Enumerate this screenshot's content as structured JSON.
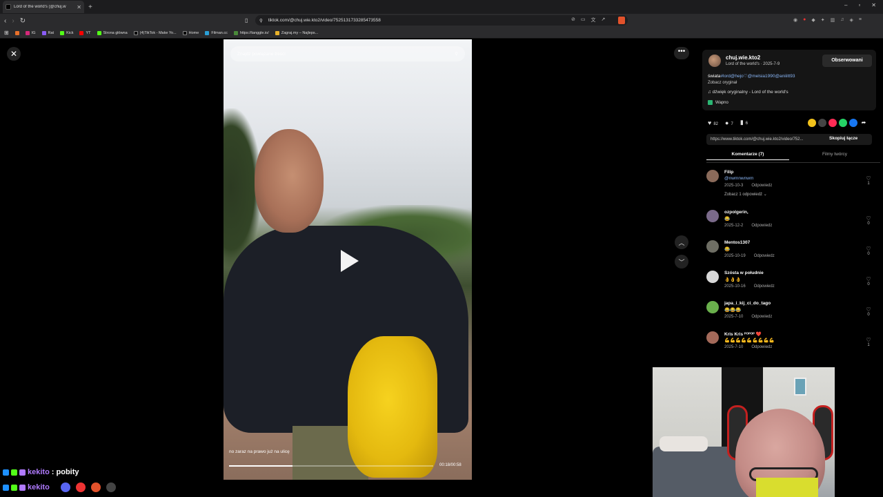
{
  "browser": {
    "tab_title": "Lord of the world's (@chuj.w",
    "url": "tiktok.com/@chuj.wie.kto2/video/7525131733285473558",
    "bookmarks": [
      "IG",
      "Rat",
      "Kick",
      "YT",
      "Strona główna",
      "(4)TikTok - Make Yo...",
      "Home",
      "Filman.cc",
      "https://tanggle.io/",
      "Zagraj.my – Najleps..."
    ]
  },
  "video": {
    "search_placeholder": "Znajdź powiązane treści",
    "caption": "no zaraz na prawo już na ulicę",
    "time": "00:18/00:58",
    "progress": 0.31
  },
  "creator": {
    "name": "chuj.wie.kto2",
    "subtitle": "Lord of the world's · 2025-7-9",
    "follow_label": "Obserwowani",
    "desc_prefix": "świata",
    "desc_tags": "#lord@hejo♡@melsia1990@aniiitt93",
    "see_original": "Zobacz oryginał",
    "sound": "♫  dźwięk oryginalny - Lord of the world's",
    "place": "Wapno"
  },
  "stats": {
    "likes": "82",
    "comments": "7",
    "saves": "6"
  },
  "link": {
    "url": "https://www.tiktok.com/@chuj.wie.kto2/video/752...",
    "copy_label": "Skopiuj łącze"
  },
  "tabs": {
    "comments": "Komentarze (7)",
    "videos": "Filmy twórcy"
  },
  "comments": [
    {
      "user": "Filip",
      "text": "@nwmnwnwm",
      "date": "2025-10-3",
      "reply": "Odpowiedz",
      "likes": "1",
      "replies": "Zobacz 1 odpowiedź ⌄",
      "avatar": "#8a6a5a"
    },
    {
      "user": "ozpolgerin,",
      "text": "😂",
      "date": "2025-12-2",
      "reply": "Odpowiedz",
      "likes": "0",
      "avatar": "#7a6a8a"
    },
    {
      "user": "Mentos1307",
      "text": "😂",
      "date": "2025-10-19",
      "reply": "Odpowiedz",
      "likes": "0",
      "avatar": "#6e6e64"
    },
    {
      "user": "Szósta w południe",
      "text": "👌👌👌",
      "date": "2025-10-16",
      "reply": "Odpowiedz",
      "likes": "0",
      "avatar": "#d8d8d8"
    },
    {
      "user": "japa_i_kij_ci_do_tago",
      "text": "😂😂😂",
      "date": "2025-7-10",
      "reply": "Odpowiedz",
      "likes": "0",
      "avatar": "#6ab04c"
    },
    {
      "user": "Kris Kris ᴾᴼᴾᴼᴾ ❤️",
      "text": "💪💪💪💪💪💪💪💪💪",
      "date": "2025-7-10",
      "reply": "Odpowiedz",
      "likes": "1",
      "avatar": "#a46a5a"
    }
  ],
  "chat": [
    {
      "user": "kekito",
      "msg": ": pobity"
    },
    {
      "user": "kekito",
      "msg": ""
    }
  ],
  "colors": {
    "accent_blue": "#8ab6f5",
    "chat_user": "#b07aff",
    "bag": "#f6d21f"
  }
}
